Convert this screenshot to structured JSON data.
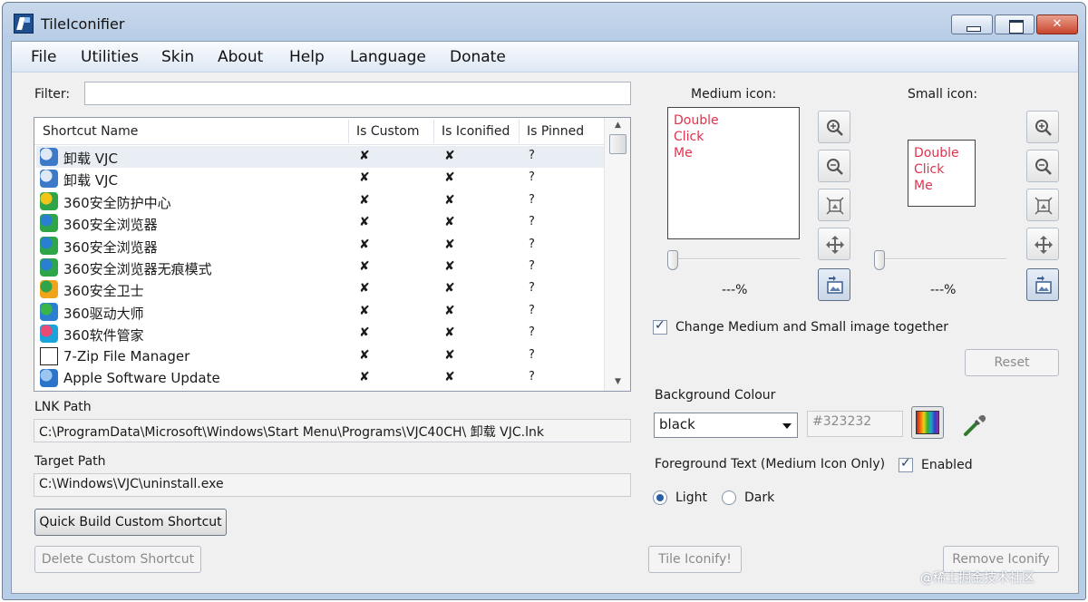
{
  "window": {
    "title": "TileIconifier"
  },
  "menu": [
    "File",
    "Utilities",
    "Skin",
    "About",
    "Help",
    "Language",
    "Donate"
  ],
  "filter": {
    "label": "Filter:",
    "value": ""
  },
  "list": {
    "columns": [
      "Shortcut Name",
      "Is Custom",
      "Is Iconified",
      "Is Pinned"
    ],
    "rows": [
      {
        "name": "卸载 VJC",
        "custom": "✘",
        "iconified": "✘",
        "pinned": "?",
        "icon": "uninstall-icon"
      },
      {
        "name": "卸载 VJC",
        "custom": "✘",
        "iconified": "✘",
        "pinned": "?",
        "icon": "uninstall-icon"
      },
      {
        "name": "360安全防护中心",
        "custom": "✘",
        "iconified": "✘",
        "pinned": "?",
        "icon": "360-icon"
      },
      {
        "name": "360安全浏览器",
        "custom": "✘",
        "iconified": "✘",
        "pinned": "?",
        "icon": "360-browser-icon"
      },
      {
        "name": "360安全浏览器",
        "custom": "✘",
        "iconified": "✘",
        "pinned": "?",
        "icon": "360-browser-icon"
      },
      {
        "name": "360安全浏览器无痕模式",
        "custom": "✘",
        "iconified": "✘",
        "pinned": "?",
        "icon": "360-browser-icon"
      },
      {
        "name": "360安全卫士",
        "custom": "✘",
        "iconified": "✘",
        "pinned": "?",
        "icon": "360-guard-icon"
      },
      {
        "name": "360驱动大师",
        "custom": "✘",
        "iconified": "✘",
        "pinned": "?",
        "icon": "360-driver-icon"
      },
      {
        "name": "360软件管家",
        "custom": "✘",
        "iconified": "✘",
        "pinned": "?",
        "icon": "360-software-icon"
      },
      {
        "name": "7-Zip File Manager",
        "custom": "✘",
        "iconified": "✘",
        "pinned": "?",
        "icon": "7zip-icon"
      },
      {
        "name": "Apple Software Update",
        "custom": "✘",
        "iconified": "✘",
        "pinned": "?",
        "icon": "apple-update-icon"
      }
    ]
  },
  "lnk": {
    "label": "LNK Path",
    "value": "C:\\ProgramData\\Microsoft\\Windows\\Start Menu\\Programs\\VJC40CH\\ 卸载 VJC.lnk"
  },
  "target": {
    "label": "Target Path",
    "value": "C:\\Windows\\VJC\\uninstall.exe"
  },
  "buttons": {
    "quick_build": "Quick Build Custom Shortcut",
    "delete_custom": "Delete Custom Shortcut",
    "tile_iconify": "Tile Iconify!",
    "remove_iconify": "Remove Iconify",
    "reset": "Reset"
  },
  "medium": {
    "label": "Medium icon:",
    "preview_text": "Double\nClick\nMe",
    "percent": "---%"
  },
  "small": {
    "label": "Small icon:",
    "preview_text": "Double\nClick\nMe",
    "percent": "---%"
  },
  "change_together": {
    "label": "Change Medium and Small image together",
    "checked": true
  },
  "background": {
    "label": "Background Colour",
    "selected": "black",
    "hex": "#323232"
  },
  "foreground": {
    "label": "Foreground Text (Medium Icon Only)",
    "enabled_label": "Enabled",
    "enabled": true
  },
  "text_theme": {
    "light": "Light",
    "dark": "Dark",
    "selected": "Light"
  },
  "watermark": "@稀土掘金技术社区"
}
